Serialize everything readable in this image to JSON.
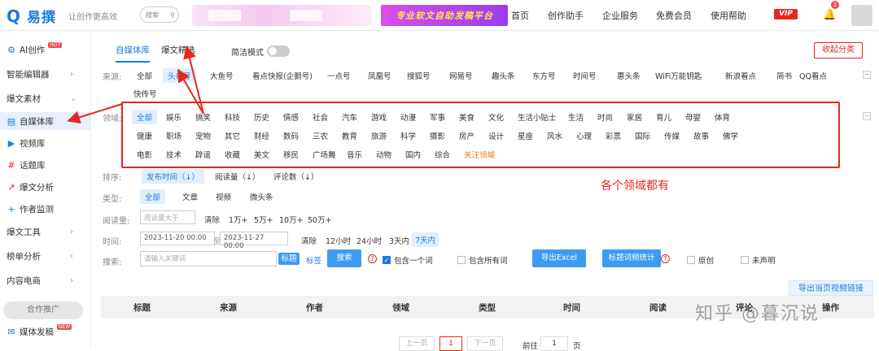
{
  "header": {
    "logo_mark": "Q",
    "logo_text": "易撰",
    "slogan": "让创作更高效",
    "search_placeholder": "搜索",
    "banner": "专业软文自助发稿平台",
    "nav": [
      "首页",
      "创作助手",
      "企业服务",
      "免费会员",
      "使用帮助"
    ],
    "vip": "VIP",
    "notification_count": "2"
  },
  "sidebar": {
    "items": [
      {
        "label": "AI创作",
        "badge": "HOT"
      },
      {
        "label": "智能编辑器"
      },
      {
        "label": "爆文素材"
      },
      {
        "label": "自媒体库"
      },
      {
        "label": "视频库"
      },
      {
        "label": "话题库"
      },
      {
        "label": "爆文分析"
      },
      {
        "label": "作者监测"
      },
      {
        "label": "爆文工具"
      },
      {
        "label": "榜单分析"
      },
      {
        "label": "内容电商"
      }
    ],
    "coop": "合作推广",
    "media": "媒体发稿",
    "media_badge": "NEW"
  },
  "main": {
    "tabs": [
      "自媒体库",
      "爆文精选"
    ],
    "simple_mode": "简洁模式",
    "collapse": "收起分类",
    "source_label": "来源:",
    "sources": [
      "全部",
      "头条号",
      "大鱼号",
      "看点快报(企鹅号)",
      "一点号",
      "凤凰号",
      "搜狐号",
      "网易号",
      "趣头条",
      "东方号",
      "时间号",
      "惠头条",
      "WiFi万能钥匙",
      "新浪看点",
      "简书",
      "QQ看点",
      "快传号"
    ],
    "field_label": "领域:",
    "fields": [
      [
        "全部",
        "娱乐",
        "搞笑",
        "科技",
        "历史",
        "情感",
        "社会",
        "汽车",
        "游戏",
        "动漫",
        "军事",
        "美食",
        "文化",
        "生活小贴士",
        "生活",
        "时尚",
        "家居",
        "育儿",
        "母婴",
        "体育"
      ],
      [
        "健康",
        "职场",
        "宠物",
        "其它",
        "财经",
        "数码",
        "三农",
        "教育",
        "旅游",
        "科学",
        "摄影",
        "房产",
        "设计",
        "星座",
        "风水",
        "心理",
        "彩票",
        "国际",
        "传媒",
        "故事",
        "佛学"
      ],
      [
        "电影",
        "技术",
        "辟谣",
        "收藏",
        "美文",
        "移民",
        "广场舞",
        "音乐",
        "动物",
        "国内",
        "综合",
        "关注领域"
      ]
    ],
    "annotation": "各个领域都有",
    "sort_label": "排序:",
    "sorts": [
      "发布时间（↓）",
      "阅读量（↓）",
      "评论数（↓）"
    ],
    "type_label": "类型:",
    "types": [
      "全部",
      "文章",
      "视频",
      "微头条"
    ],
    "read_label": "阅读量:",
    "read_placeholder": "阅读量大于",
    "read_opts": [
      "清除",
      "1万+",
      "5万+",
      "10万+",
      "50万+"
    ],
    "time_label": "时间:",
    "time_start": "2023-11-20 00:00",
    "time_sep": "至",
    "time_end": "2023-11-27 00:00",
    "time_opts": [
      "清除",
      "12小时",
      "24小时",
      "3天内",
      "7天内"
    ],
    "search_label": "搜索:",
    "search_placeholder": "请输入关键词",
    "search_modes": [
      "标题",
      "标签"
    ],
    "search_btn": "搜索",
    "contains_one": "包含一个词",
    "contains_all": "包含所有词",
    "export_excel": "导出Excel",
    "title_stats": "标题词频统计",
    "original": "原创",
    "undeclared": "未声明",
    "export_video": "导出当页视频链接",
    "columns": [
      "标题",
      "来源",
      "作者",
      "领域",
      "类型",
      "时间",
      "阅读",
      "评论",
      "操作"
    ],
    "pager": {
      "prev": "上一页",
      "page": "1",
      "next": "下一页",
      "goto": "前往",
      "goto_val": "1",
      "unit": "页"
    },
    "watermark": "知乎 @暮沉说"
  },
  "colors": {
    "accent": "#1a7be0",
    "annotation": "#e8261d"
  }
}
